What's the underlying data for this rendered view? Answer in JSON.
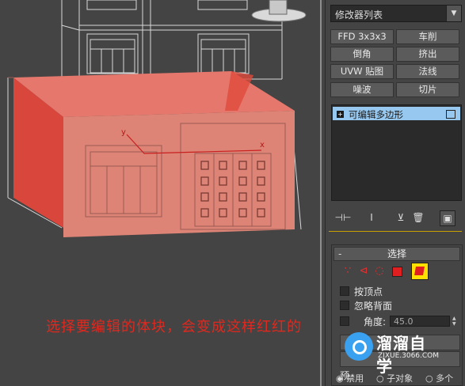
{
  "caption": "选择要编辑的体块，会变成这样红红的",
  "modifier_list": {
    "label": "修改器列表",
    "arrow": "▼"
  },
  "modifier_buttons": [
    "FFD 3x3x3",
    "车削",
    "倒角",
    "挤出",
    "UVW 贴图",
    "法线",
    "噪波",
    "切片"
  ],
  "stack": {
    "item": "可编辑多边形",
    "expand": "+"
  },
  "stack_tools": {
    "pin": "⊣⊢",
    "show_end": "Ι",
    "make_unique": "⊻",
    "remove": "🗑",
    "configure": "▣"
  },
  "rollout": {
    "title": "选择",
    "collapse": "-",
    "options": {
      "by_vertex": "按顶点",
      "ignore_backface": "忽略背面",
      "angle_label": "角度:",
      "angle_value": "45.0"
    },
    "preview_label": "预",
    "bottom_options": [
      "禁用",
      "子对象",
      "多个"
    ]
  },
  "viewport_axes": {
    "x": "x",
    "y": "y"
  },
  "watermark": {
    "name": "溜溜自学",
    "url": "ZIXUE.3066.COM"
  },
  "colors": {
    "selection_red": "#e0786a",
    "caption_red": "#e0281e",
    "highlight_blue": "#96c8f0",
    "active_yellow": "#ffe000"
  }
}
